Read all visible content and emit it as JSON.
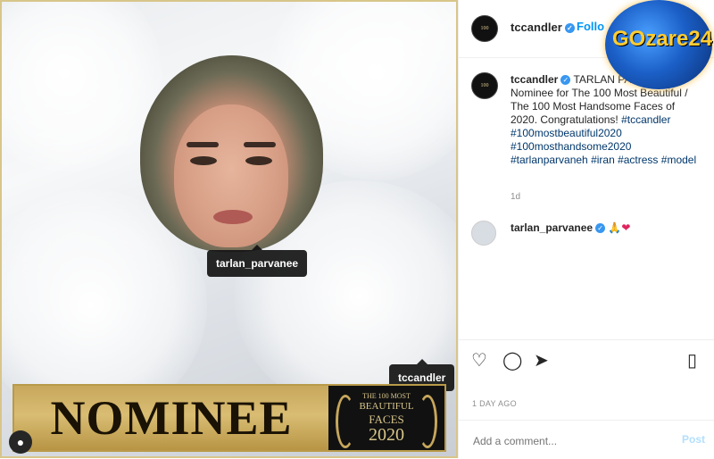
{
  "photo": {
    "tags": [
      "tarlan_parvanee",
      "tccandler"
    ],
    "banner": {
      "word": "NOMINEE",
      "line1": "THE 100 MOST",
      "line2": "BEAUTIFUL",
      "line3": "FACES",
      "year": "2020"
    }
  },
  "header": {
    "username": "tccandler",
    "follow_label": "Follo"
  },
  "watermark": {
    "text": "GOzare24"
  },
  "caption": {
    "username": "tccandler",
    "text_intro": "TARLAN PAR",
    "text_body": "Official Nominee for The 100 Most Beautiful / The 100 Most Handsome Faces of 2020. Congratulations!",
    "hashtags": "#tccandler #100mostbeautiful2020 #100mosthandsome2020 #tarlanparvaneh #iran #actress #model",
    "time": "1d"
  },
  "comment": {
    "username": "tarlan_parvanee",
    "emoji": "🙏",
    "heart": "❤"
  },
  "post_date": "1 DAY AGO",
  "add_comment": {
    "placeholder": "Add a comment...",
    "post_label": "Post"
  },
  "icons": [
    "heart-icon",
    "comment-icon",
    "share-icon",
    "bookmark-icon",
    "user-tag-icon"
  ]
}
